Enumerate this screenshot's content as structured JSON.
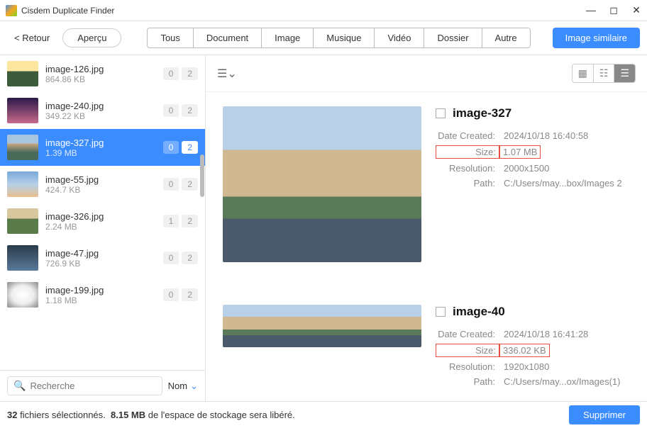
{
  "app": {
    "title": "Cisdem Duplicate Finder"
  },
  "toolbar": {
    "back": "< Retour",
    "preview": "Aperçu",
    "tabs": [
      "Tous",
      "Document",
      "Image",
      "Musique",
      "Vidéo",
      "Dossier",
      "Autre"
    ],
    "similar": "Image similaire"
  },
  "list": {
    "items": [
      {
        "name": "image-126.jpg",
        "size": "864.86 KB",
        "a": "0",
        "b": "2",
        "cls": "sun"
      },
      {
        "name": "image-240.jpg",
        "size": "349.22 KB",
        "a": "0",
        "b": "2",
        "cls": "sky"
      },
      {
        "name": "image-327.jpg",
        "size": "1.39 MB",
        "a": "0",
        "b": "2",
        "cls": "canal",
        "selected": true
      },
      {
        "name": "image-55.jpg",
        "size": "424.7 KB",
        "a": "0",
        "b": "2",
        "cls": "clouds"
      },
      {
        "name": "image-326.jpg",
        "size": "2.24 MB",
        "a": "1",
        "b": "2",
        "cls": "field"
      },
      {
        "name": "image-47.jpg",
        "size": "726.9 KB",
        "a": "0",
        "b": "2",
        "cls": "water"
      },
      {
        "name": "image-199.jpg",
        "size": "1.18 MB",
        "a": "0",
        "b": "2",
        "cls": "dandelion"
      }
    ]
  },
  "search": {
    "placeholder": "Recherche",
    "sort": "Nom"
  },
  "detail": {
    "items": [
      {
        "title": "image-327",
        "created_lbl": "Date Created:",
        "created": "2024/10/18 16:40:58",
        "size_lbl": "Size:",
        "size": "1.07 MB",
        "res_lbl": "Resolution:",
        "res": "2000x1500",
        "path_lbl": "Path:",
        "path": "C:/Users/may...box/Images 2"
      },
      {
        "title": "image-40",
        "created_lbl": "Date Created:",
        "created": "2024/10/18 16:41:28",
        "size_lbl": "Size:",
        "size": "336.02 KB",
        "res_lbl": "Resolution:",
        "res": "1920x1080",
        "path_lbl": "Path:",
        "path": "C:/Users/may...ox/Images(1)"
      }
    ]
  },
  "footer": {
    "count": "32",
    "count_suffix": "fichiers sélectionnés.",
    "size": "8.15 MB",
    "size_suffix": "de l'espace de stockage sera libéré.",
    "delete": "Supprimer"
  }
}
